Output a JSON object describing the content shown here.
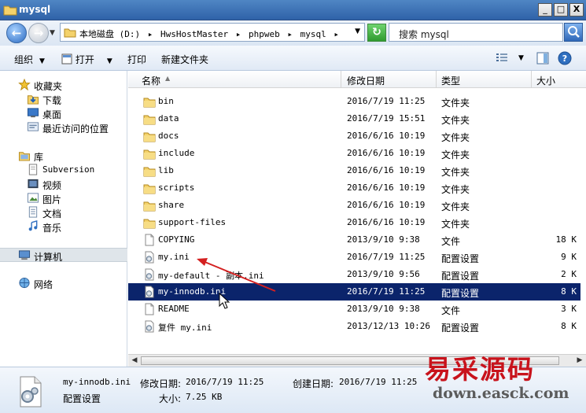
{
  "window": {
    "title": "mysql"
  },
  "titlebar_buttons": [
    "_",
    "□",
    "X"
  ],
  "address": {
    "crumbs": [
      "本地磁盘 (D:)",
      "▸",
      "HwsHostMaster",
      "▸",
      "phpweb",
      "▸",
      "mysql",
      "▸"
    ],
    "search_placeholder": "搜索 mysql"
  },
  "toolbar": {
    "organize": "组织",
    "open": "打开",
    "print": "打印",
    "new_folder": "新建文件夹"
  },
  "navpane": {
    "favorites": "收藏夹",
    "downloads": "下载",
    "desktop": "桌面",
    "recent": "最近访问的位置",
    "libraries": "库",
    "subversion": "Subversion",
    "videos": "视频",
    "pictures": "图片",
    "documents": "文档",
    "music": "音乐",
    "computer": "计算机",
    "network": "网络"
  },
  "columns": {
    "name": "名称",
    "date": "修改日期",
    "type": "类型",
    "size": "大小"
  },
  "files": [
    {
      "name": "bin",
      "date": "2016/7/19 11:25",
      "type": "文件夹",
      "size": "",
      "kind": "folder"
    },
    {
      "name": "data",
      "date": "2016/7/19 15:51",
      "type": "文件夹",
      "size": "",
      "kind": "folder"
    },
    {
      "name": "docs",
      "date": "2016/6/16 10:19",
      "type": "文件夹",
      "size": "",
      "kind": "folder"
    },
    {
      "name": "include",
      "date": "2016/6/16 10:19",
      "type": "文件夹",
      "size": "",
      "kind": "folder"
    },
    {
      "name": "lib",
      "date": "2016/6/16 10:19",
      "type": "文件夹",
      "size": "",
      "kind": "folder"
    },
    {
      "name": "scripts",
      "date": "2016/6/16 10:19",
      "type": "文件夹",
      "size": "",
      "kind": "folder"
    },
    {
      "name": "share",
      "date": "2016/6/16 10:19",
      "type": "文件夹",
      "size": "",
      "kind": "folder"
    },
    {
      "name": "support-files",
      "date": "2016/6/16 10:19",
      "type": "文件夹",
      "size": "",
      "kind": "folder"
    },
    {
      "name": "COPYING",
      "date": "2013/9/10 9:38",
      "type": "文件",
      "size": "18 K",
      "kind": "file"
    },
    {
      "name": "my.ini",
      "date": "2016/7/19 11:25",
      "type": "配置设置",
      "size": "9 K",
      "kind": "ini"
    },
    {
      "name": "my-default - 副本.ini",
      "date": "2013/9/10 9:56",
      "type": "配置设置",
      "size": "2 K",
      "kind": "ini"
    },
    {
      "name": "my-innodb.ini",
      "date": "2016/7/19 11:25",
      "type": "配置设置",
      "size": "8 K",
      "kind": "ini",
      "selected": true
    },
    {
      "name": "README",
      "date": "2013/9/10 9:38",
      "type": "文件",
      "size": "3 K",
      "kind": "file"
    },
    {
      "name": "复件 my.ini",
      "date": "2013/12/13 10:26",
      "type": "配置设置",
      "size": "8 K",
      "kind": "ini"
    }
  ],
  "details": {
    "filename": "my-innodb.ini",
    "modified_label": "修改日期:",
    "modified": "2016/7/19 11:25",
    "created_label": "创建日期:",
    "created": "2016/7/19 11:25",
    "type": "配置设置",
    "size_label": "大小:",
    "size": "7.25 KB"
  },
  "watermark": {
    "brand": "易采源码",
    "url": "down.easck.com"
  },
  "colors": {
    "selection": "#0b246b",
    "arrow": "#d42020",
    "watermark": "#c8131c"
  }
}
